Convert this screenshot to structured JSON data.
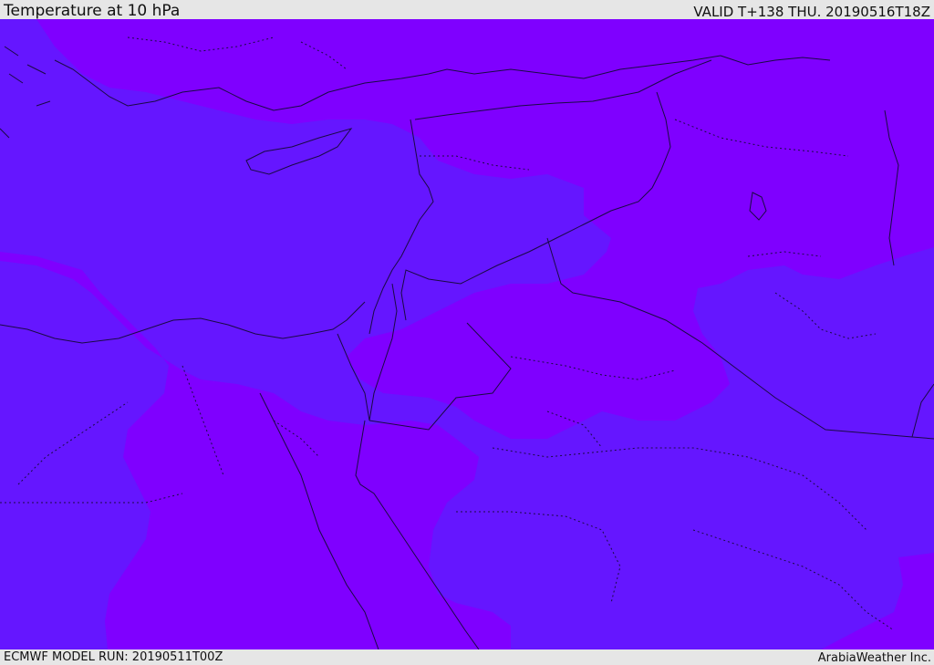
{
  "header": {
    "title": "Temperature at 10 hPa",
    "valid": "VALID T+138 THU. 20190516T18Z"
  },
  "footer": {
    "model_run": "ECMWF MODEL RUN: 20190511T00Z",
    "credit": "ArabiaWeather Inc."
  },
  "map": {
    "region": "Eastern Mediterranean and Middle East",
    "field": "temperature",
    "colors": {
      "cool_band": "#6516ff",
      "warm_band": "#7f00ff",
      "coastline": "#1a0a44",
      "borders": "#1a0a44"
    }
  }
}
